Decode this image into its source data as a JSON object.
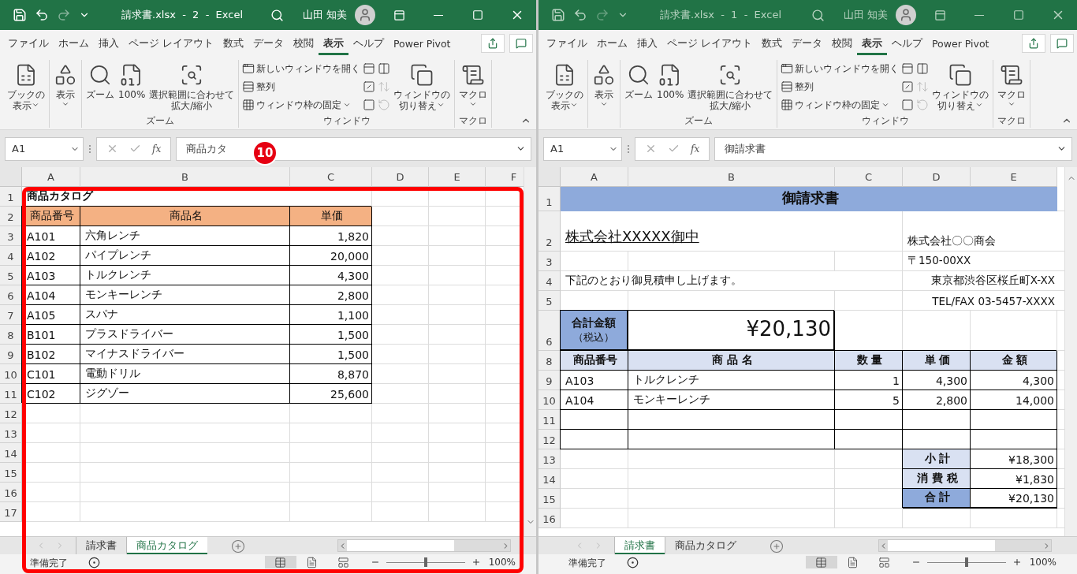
{
  "windows": [
    {
      "active": true,
      "highlighted": true,
      "annotation": {
        "label": "10"
      },
      "title": "請求書.xlsx  -  2  -  Excel",
      "user": "山田 知美",
      "tabs": [
        {
          "label": "ファイル",
          "selected": false
        },
        {
          "label": "ホーム",
          "selected": false
        },
        {
          "label": "挿入",
          "selected": false
        },
        {
          "label": "ページ レイアウト",
          "selected": false
        },
        {
          "label": "数式",
          "selected": false
        },
        {
          "label": "データ",
          "selected": false
        },
        {
          "label": "校閲",
          "selected": false
        },
        {
          "label": "表示",
          "selected": true
        },
        {
          "label": "ヘルプ",
          "selected": false
        },
        {
          "label": "Power Pivot",
          "selected": false
        }
      ],
      "groups": [
        {
          "buttons": [
            {
              "kind": "large",
              "lines": [
                "ブックの",
                "表示"
              ],
              "dropdown": true,
              "disabled": false
            }
          ]
        },
        {
          "buttons": [
            {
              "kind": "large",
              "lines": [
                "表示"
              ],
              "dropdown": true,
              "disabled": false
            }
          ]
        },
        {
          "label": "ズーム",
          "buttons": [
            {
              "kind": "large",
              "lines": [
                "ズーム"
              ],
              "dropdown": false,
              "disabled": false
            },
            {
              "kind": "large",
              "lines": [
                "100%"
              ],
              "dropdown": false,
              "disabled": false
            },
            {
              "kind": "large",
              "lines": [
                "選択範囲に合わせて",
                "拡大/縮小"
              ],
              "dropdown": false,
              "disabled": false
            }
          ]
        },
        {
          "label": "ウィンドウ",
          "buttons": [
            {
              "kind": "small",
              "lines": [
                "新しいウィンドウを開く"
              ],
              "dropdown": false,
              "disabled": false
            },
            {
              "kind": "small",
              "lines": [
                "整列"
              ],
              "dropdown": false,
              "disabled": false
            },
            {
              "kind": "small",
              "lines": [
                "ウィンドウ枠の固定"
              ],
              "dropdown": true,
              "disabled": false
            },
            {
              "kind": "icon",
              "dropdown": false,
              "disabled": false
            },
            {
              "kind": "icon",
              "dropdown": false,
              "disabled": false
            },
            {
              "kind": "icon",
              "dropdown": false,
              "disabled": false
            },
            {
              "kind": "icon",
              "dropdown": false,
              "disabled": false
            },
            {
              "kind": "icon",
              "dropdown": false,
              "disabled": true
            },
            {
              "kind": "icon",
              "dropdown": false,
              "disabled": true
            },
            {
              "kind": "large",
              "lines": [
                "ウィンドウの",
                "切り替え"
              ],
              "dropdown": true,
              "disabled": false
            }
          ]
        },
        {
          "label": "マクロ",
          "buttons": [
            {
              "kind": "large",
              "lines": [
                "マクロ"
              ],
              "dropdown": true,
              "disabled": false
            }
          ]
        }
      ],
      "formula": {
        "name_box": "A1",
        "function_label": "fx",
        "content": "商品カタ"
      },
      "sheet": {
        "kind": "catalog",
        "columns": [
          "A",
          "B",
          "C",
          "D",
          "E",
          "F"
        ],
        "rows": [
          {
            "num": "1",
            "kind": "normal",
            "cells": [
              {
                "text": "商品カタログ",
                "kind": "title"
              }
            ]
          },
          {
            "num": "2",
            "kind": "normal",
            "cells": [
              {
                "text": "商品番号",
                "kind": "head"
              },
              {
                "text": "商品名",
                "kind": "head"
              },
              {
                "text": "単価",
                "kind": "head"
              }
            ]
          },
          {
            "num": "3",
            "kind": "normal",
            "cells": [
              {
                "text": "A101",
                "kind": "text"
              },
              {
                "text": "六角レンチ",
                "kind": "text"
              },
              {
                "text": "1,820",
                "kind": "num"
              }
            ]
          },
          {
            "num": "4",
            "kind": "normal",
            "cells": [
              {
                "text": "A102",
                "kind": "text"
              },
              {
                "text": "パイプレンチ",
                "kind": "text"
              },
              {
                "text": "20,000",
                "kind": "num"
              }
            ]
          },
          {
            "num": "5",
            "kind": "normal",
            "cells": [
              {
                "text": "A103",
                "kind": "text"
              },
              {
                "text": "トルクレンチ",
                "kind": "text"
              },
              {
                "text": "4,300",
                "kind": "num"
              }
            ]
          },
          {
            "num": "6",
            "kind": "normal",
            "cells": [
              {
                "text": "A104",
                "kind": "text"
              },
              {
                "text": "モンキーレンチ",
                "kind": "text"
              },
              {
                "text": "2,800",
                "kind": "num"
              }
            ]
          },
          {
            "num": "7",
            "kind": "normal",
            "cells": [
              {
                "text": "A105",
                "kind": "text"
              },
              {
                "text": "スパナ",
                "kind": "text"
              },
              {
                "text": "1,100",
                "kind": "num"
              }
            ]
          },
          {
            "num": "8",
            "kind": "normal",
            "cells": [
              {
                "text": "B101",
                "kind": "text"
              },
              {
                "text": "プラスドライバー",
                "kind": "text"
              },
              {
                "text": "1,500",
                "kind": "num"
              }
            ]
          },
          {
            "num": "9",
            "kind": "normal",
            "cells": [
              {
                "text": "B102",
                "kind": "text"
              },
              {
                "text": "マイナスドライバー",
                "kind": "text"
              },
              {
                "text": "1,500",
                "kind": "num"
              }
            ]
          },
          {
            "num": "10",
            "kind": "normal",
            "cells": [
              {
                "text": "C101",
                "kind": "text"
              },
              {
                "text": "電動ドリル",
                "kind": "text"
              },
              {
                "text": "8,870",
                "kind": "num"
              }
            ]
          },
          {
            "num": "11",
            "kind": "normal",
            "cells": [
              {
                "text": "C102",
                "kind": "text"
              },
              {
                "text": "ジグゾー",
                "kind": "text"
              },
              {
                "text": "25,600",
                "kind": "num"
              }
            ]
          },
          {
            "num": "12",
            "kind": "normal",
            "cells": []
          },
          {
            "num": "13",
            "kind": "normal",
            "cells": []
          },
          {
            "num": "14",
            "kind": "normal",
            "cells": []
          },
          {
            "num": "15",
            "kind": "normal",
            "cells": []
          },
          {
            "num": "16",
            "kind": "normal",
            "cells": []
          },
          {
            "num": "17",
            "kind": "normal",
            "cells": []
          }
        ]
      },
      "sheet_tabs": [
        {
          "label": "請求書",
          "selected": false
        },
        {
          "label": "商品カタログ",
          "selected": true
        }
      ],
      "status": {
        "text": "準備完了",
        "views": [
          {
            "selected": true
          },
          {
            "selected": false
          },
          {
            "selected": false
          }
        ],
        "zoom": {
          "level": 0.5,
          "reading": "100%"
        }
      }
    },
    {
      "active": false,
      "highlighted": false,
      "title": "請求書.xlsx  -  1  -  Excel",
      "user": "山田 知美",
      "tabs": [
        {
          "label": "ファイル",
          "selected": false
        },
        {
          "label": "ホーム",
          "selected": false
        },
        {
          "label": "挿入",
          "selected": false
        },
        {
          "label": "ページ レイアウト",
          "selected": false
        },
        {
          "label": "数式",
          "selected": false
        },
        {
          "label": "データ",
          "selected": false
        },
        {
          "label": "校閲",
          "selected": false
        },
        {
          "label": "表示",
          "selected": true
        },
        {
          "label": "ヘルプ",
          "selected": false
        },
        {
          "label": "Power Pivot",
          "selected": false
        }
      ],
      "groups": [
        {
          "buttons": [
            {
              "kind": "large",
              "lines": [
                "ブックの",
                "表示"
              ],
              "dropdown": true,
              "disabled": false
            }
          ]
        },
        {
          "buttons": [
            {
              "kind": "large",
              "lines": [
                "表示"
              ],
              "dropdown": true,
              "disabled": false
            }
          ]
        },
        {
          "label": "ズーム",
          "buttons": [
            {
              "kind": "large",
              "lines": [
                "ズーム"
              ],
              "dropdown": false,
              "disabled": false
            },
            {
              "kind": "large",
              "lines": [
                "100%"
              ],
              "dropdown": false,
              "disabled": false
            },
            {
              "kind": "large",
              "lines": [
                "選択範囲に合わせて",
                "拡大/縮小"
              ],
              "dropdown": false,
              "disabled": false
            }
          ]
        },
        {
          "label": "ウィンドウ",
          "buttons": [
            {
              "kind": "small",
              "lines": [
                "新しいウィンドウを開く"
              ],
              "dropdown": false,
              "disabled": false
            },
            {
              "kind": "small",
              "lines": [
                "整列"
              ],
              "dropdown": false,
              "disabled": false
            },
            {
              "kind": "small",
              "lines": [
                "ウィンドウ枠の固定"
              ],
              "dropdown": true,
              "disabled": false
            },
            {
              "kind": "icon",
              "dropdown": false,
              "disabled": false
            },
            {
              "kind": "icon",
              "dropdown": false,
              "disabled": false
            },
            {
              "kind": "icon",
              "dropdown": false,
              "disabled": false
            },
            {
              "kind": "icon",
              "dropdown": false,
              "disabled": false
            },
            {
              "kind": "icon",
              "dropdown": false,
              "disabled": true
            },
            {
              "kind": "icon",
              "dropdown": false,
              "disabled": true
            },
            {
              "kind": "large",
              "lines": [
                "ウィンドウの",
                "切り替え"
              ],
              "dropdown": true,
              "disabled": false
            }
          ]
        },
        {
          "label": "マクロ",
          "buttons": [
            {
              "kind": "large",
              "lines": [
                "マクロ"
              ],
              "dropdown": true,
              "disabled": false
            }
          ]
        }
      ],
      "formula": {
        "name_box": "A1",
        "function_label": "fx",
        "content": "御請求書"
      },
      "sheet": {
        "kind": "invoice",
        "columns": [
          "A",
          "B",
          "C",
          "D",
          "E"
        ],
        "rows": [
          {
            "num": "1",
            "kind": "banner",
            "cells": [
              {
                "text": "御請求書",
                "kind": "banner"
              }
            ]
          },
          {
            "num": "2",
            "kind": "tall",
            "cells": [
              {
                "text": "株式会社XXXXX御中",
                "kind": "addressee"
              },
              {},
              {
                "text": "株式会社〇〇商会",
                "kind": "sender"
              }
            ]
          },
          {
            "num": "3",
            "kind": "normal",
            "cells": [
              {},
              {},
              {},
              {
                "text": "〒150-00XX",
                "kind": "sender"
              }
            ]
          },
          {
            "num": "4",
            "kind": "normal",
            "cells": [
              {
                "text": "下記のとおり御見積申し上げます。",
                "kind": "note"
              },
              {},
              {
                "text": "東京都渋谷区桜丘町X-XX",
                "kind": "right"
              }
            ]
          },
          {
            "num": "5",
            "kind": "normal",
            "cells": [
              {},
              {},
              {},
              {
                "text": "TEL/FAX 03-5457-XXXX",
                "kind": "right"
              }
            ]
          },
          {
            "num": "6",
            "kind": "tall",
            "cells": [
              {
                "text": "合計金額",
                "sub": "（税込）",
                "kind": "total-label"
              },
              {
                "text": "¥20,130",
                "kind": "total"
              }
            ]
          },
          {
            "num": "8",
            "kind": "normal",
            "cells": [
              {
                "text": "商品番号",
                "kind": "head-blue"
              },
              {
                "text": "商 品 名",
                "kind": "head-blue"
              },
              {
                "text": "数 量",
                "kind": "head-blue"
              },
              {
                "text": "単 価",
                "kind": "head-blue"
              },
              {
                "text": "金 額",
                "kind": "head-blue"
              }
            ]
          },
          {
            "num": "9",
            "kind": "normal",
            "cells": [
              {
                "text": "A103",
                "kind": "text"
              },
              {
                "text": "トルクレンチ",
                "kind": "text"
              },
              {
                "text": "1",
                "kind": "num"
              },
              {
                "text": "4,300",
                "kind": "num"
              },
              {
                "text": "4,300",
                "kind": "num"
              }
            ]
          },
          {
            "num": "10",
            "kind": "normal",
            "cells": [
              {
                "text": "A104",
                "kind": "text"
              },
              {
                "text": "モンキーレンチ",
                "kind": "text"
              },
              {
                "text": "5",
                "kind": "num"
              },
              {
                "text": "2,800",
                "kind": "num"
              },
              {
                "text": "14,000",
                "kind": "num"
              }
            ]
          },
          {
            "num": "11",
            "kind": "normal",
            "cells": [
              {
                "kind": "box"
              },
              {
                "kind": "box"
              },
              {
                "kind": "box"
              },
              {
                "kind": "box"
              },
              {
                "kind": "box"
              }
            ]
          },
          {
            "num": "12",
            "kind": "normal",
            "cells": [
              {
                "kind": "box"
              },
              {
                "kind": "box"
              },
              {
                "kind": "box"
              },
              {
                "kind": "box"
              },
              {
                "kind": "box"
              }
            ]
          },
          {
            "num": "13",
            "kind": "normal",
            "cells": [
              {},
              {},
              {},
              {
                "text": "小 計",
                "kind": "sum-label"
              },
              {
                "text": "¥18,300",
                "kind": "num"
              }
            ]
          },
          {
            "num": "14",
            "kind": "normal",
            "cells": [
              {},
              {},
              {},
              {
                "text": "消 費 税",
                "kind": "sum-label"
              },
              {
                "text": "¥1,830",
                "kind": "num"
              }
            ]
          },
          {
            "num": "15",
            "kind": "normal",
            "cells": [
              {},
              {},
              {},
              {
                "text": "合 計",
                "kind": "grand-label"
              },
              {
                "text": "¥20,130",
                "kind": "grand"
              }
            ]
          },
          {
            "num": "16",
            "kind": "normal",
            "cells": []
          }
        ]
      },
      "sheet_tabs": [
        {
          "label": "請求書",
          "selected": true
        },
        {
          "label": "商品カタログ",
          "selected": false
        }
      ],
      "status": {
        "text": "準備完了",
        "views": [
          {
            "selected": true
          },
          {
            "selected": false
          },
          {
            "selected": false
          }
        ],
        "zoom": {
          "level": 0.5,
          "reading": "100%"
        }
      }
    }
  ]
}
